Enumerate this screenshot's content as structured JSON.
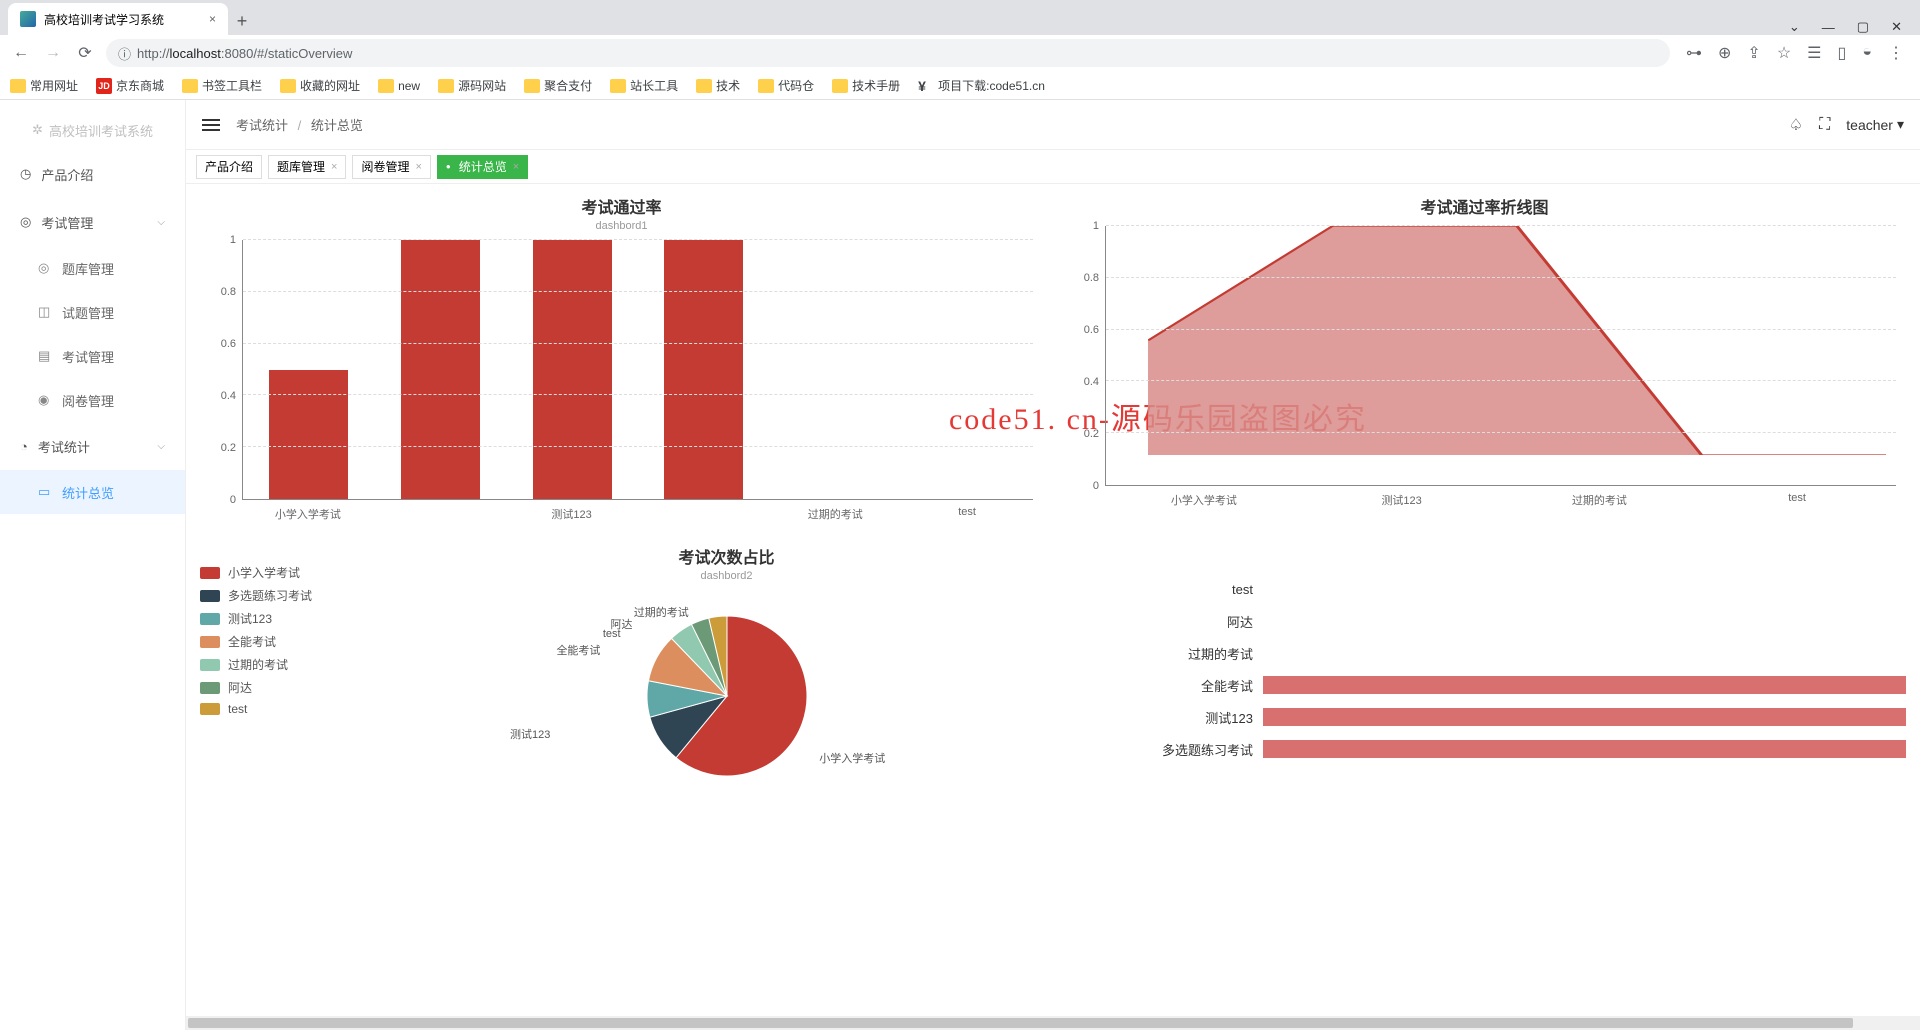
{
  "browser": {
    "tab_title": "高校培训考试学习系统",
    "url_display_host": "localhost",
    "url_display_port": ":8080",
    "url_display_path": "/#/staticOverview",
    "url_scheme": "http://"
  },
  "bookmarks": [
    {
      "label": "常用网址",
      "kind": "folder"
    },
    {
      "label": "京东商城",
      "kind": "jd"
    },
    {
      "label": "书签工具栏",
      "kind": "folder"
    },
    {
      "label": "收藏的网址",
      "kind": "folder"
    },
    {
      "label": "new",
      "kind": "folder"
    },
    {
      "label": "源码网站",
      "kind": "folder"
    },
    {
      "label": "聚合支付",
      "kind": "folder"
    },
    {
      "label": "站长工具",
      "kind": "folder"
    },
    {
      "label": "技术",
      "kind": "folder"
    },
    {
      "label": "代码仓",
      "kind": "folder"
    },
    {
      "label": "技术手册",
      "kind": "folder"
    },
    {
      "label": "项目下载:code51.cn",
      "kind": "yy"
    }
  ],
  "sidebar": {
    "logo_text": "高校培训考试系统",
    "items": [
      {
        "label": "产品介绍",
        "icon": "◷",
        "expandable": false
      },
      {
        "label": "考试管理",
        "icon": "◎",
        "expandable": true,
        "children": [
          {
            "label": "题库管理",
            "icon": "◎"
          },
          {
            "label": "试题管理",
            "icon": "◫"
          },
          {
            "label": "考试管理",
            "icon": "▤"
          },
          {
            "label": "阅卷管理",
            "icon": "◉"
          }
        ]
      },
      {
        "label": "考试统计",
        "icon": "◔",
        "expandable": true,
        "children": [
          {
            "label": "统计总览",
            "icon": "▭",
            "active": true
          }
        ]
      }
    ]
  },
  "topbar": {
    "breadcrumb": [
      "考试统计",
      "统计总览"
    ],
    "user": "teacher"
  },
  "page_tabs": [
    {
      "label": "产品介绍"
    },
    {
      "label": "题库管理",
      "closable": true
    },
    {
      "label": "阅卷管理",
      "closable": true
    },
    {
      "label": "统计总览",
      "active": true
    }
  ],
  "watermark": "code51. cn-源码乐园盗图必究",
  "chart_data": [
    {
      "type": "bar",
      "title": "考试通过率",
      "subtitle": "dashbord1",
      "categories": [
        "小学入学考试",
        "测试123",
        "过期的考试",
        "test"
      ],
      "values": [
        0.5,
        1,
        1,
        1,
        0,
        0
      ],
      "display_categories_span": "plot shows 6 bar slots, labels at positions 1,3,5,6 approx",
      "ylim": [
        0,
        1
      ],
      "yticks": [
        0,
        0.2,
        0.4,
        0.6,
        0.8,
        1
      ],
      "color": "#c33b33"
    },
    {
      "type": "area",
      "title": "考试通过率折线图",
      "x_categories": [
        "小学入学考试",
        "测试123",
        "过期的考试",
        "test"
      ],
      "values": [
        0.5,
        1,
        1,
        0,
        0
      ],
      "ylim": [
        0,
        1
      ],
      "yticks": [
        0,
        0.2,
        0.4,
        0.6,
        0.8,
        1
      ],
      "fill_color": "#d88b88",
      "line_color": "#c33b33"
    },
    {
      "type": "pie",
      "title": "考试次数占比",
      "subtitle": "dashbord2",
      "series": [
        {
          "name": "小学入学考试",
          "value": 50,
          "color": "#c33b33"
        },
        {
          "name": "多选题练习考试",
          "value": 8,
          "color": "#2f4554"
        },
        {
          "name": "测试123",
          "value": 6,
          "color": "#5fa8a7"
        },
        {
          "name": "全能考试",
          "value": 8,
          "color": "#dd8e5e"
        },
        {
          "name": "过期的考试",
          "value": 4,
          "color": "#90c9b0"
        },
        {
          "name": "阿达",
          "value": 3,
          "color": "#6d9a76"
        },
        {
          "name": "test",
          "value": 3,
          "color": "#cc9b3a"
        }
      ]
    },
    {
      "type": "bar",
      "orientation": "horizontal",
      "categories": [
        "test",
        "阿达",
        "过期的考试",
        "全能考试",
        "测试123",
        "多选题练习考试"
      ],
      "values": [
        0,
        0,
        0,
        1,
        1,
        1
      ],
      "color": "#d8706f"
    }
  ],
  "legend": [
    {
      "label": "小学入学考试",
      "color": "#c33b33"
    },
    {
      "label": "多选题练习考试",
      "color": "#2f4554"
    },
    {
      "label": "测试123",
      "color": "#5fa8a7"
    },
    {
      "label": "全能考试",
      "color": "#dd8e5e"
    },
    {
      "label": "过期的考试",
      "color": "#90c9b0"
    },
    {
      "label": "阿达",
      "color": "#6d9a76"
    },
    {
      "label": "test",
      "color": "#cc9b3a"
    }
  ],
  "pie_labels": [
    "过期的考试",
    "阿达",
    "test",
    "全能考试",
    "测试123",
    "小学入学考试"
  ]
}
